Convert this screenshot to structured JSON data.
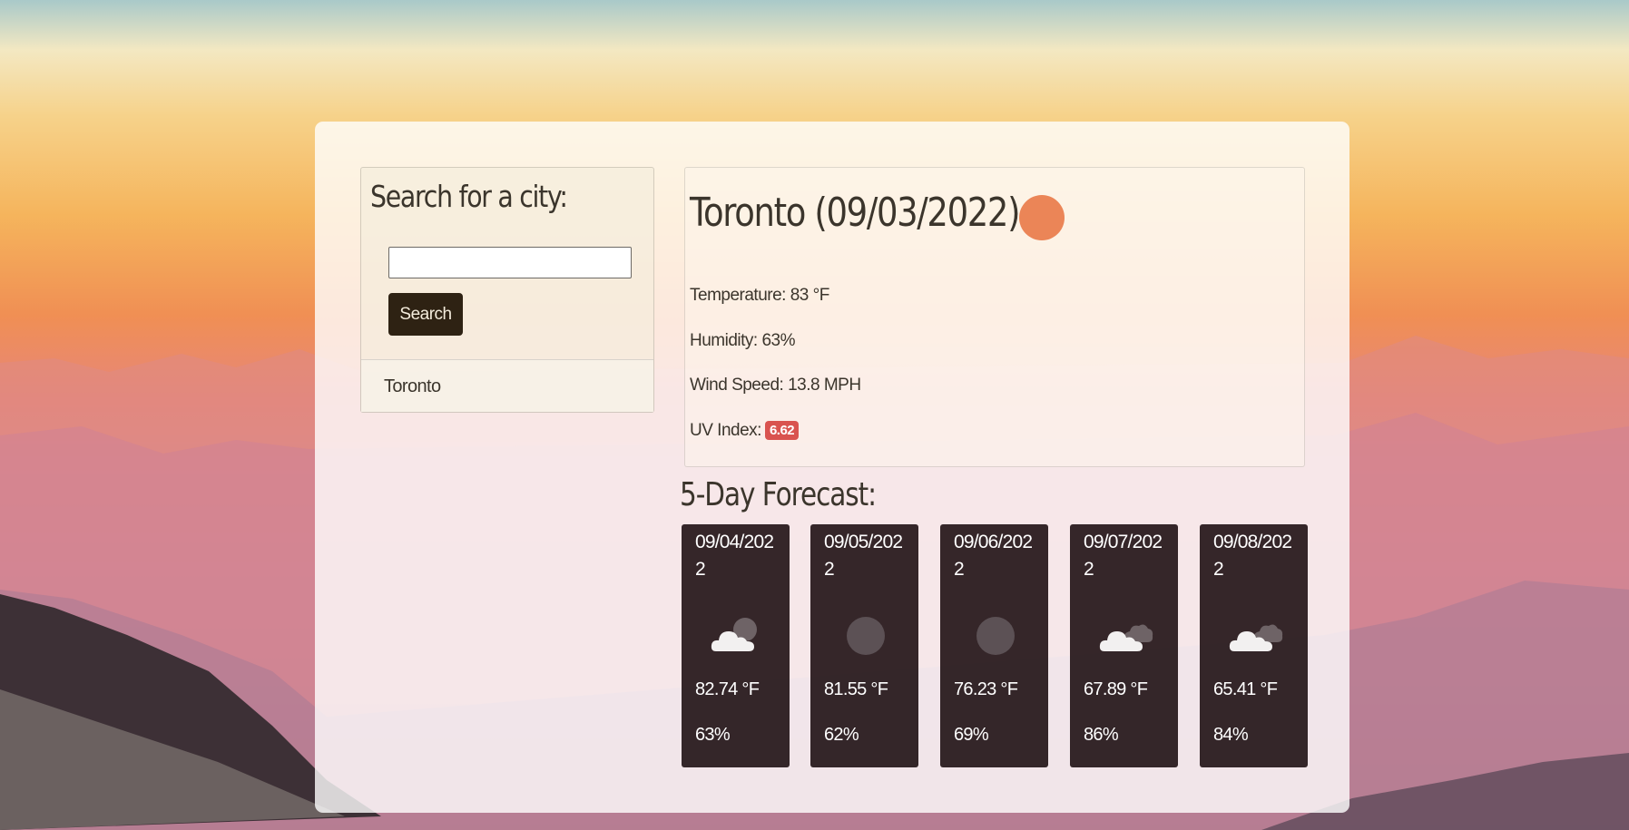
{
  "search": {
    "heading": "Search for a city:",
    "input_value": "",
    "button_label": "Search",
    "history": [
      "Toronto"
    ]
  },
  "current": {
    "title": "Toronto (09/03/2022)",
    "icon": "sun-icon",
    "temperature": "Temperature: 83 °F",
    "humidity": "Humidity: 63%",
    "wind": "Wind Speed: 13.8 MPH",
    "uv_label": "UV Index:",
    "uv_value": "6.62"
  },
  "forecast": {
    "heading": "5-Day Forecast:",
    "days": [
      {
        "date": "09/04/2022",
        "icon": "partly-cloudy-icon",
        "temp": "82.74 °F",
        "humidity": "63%"
      },
      {
        "date": "09/05/2022",
        "icon": "sun-icon",
        "temp": "81.55 °F",
        "humidity": "62%"
      },
      {
        "date": "09/06/2022",
        "icon": "sun-icon",
        "temp": "76.23 °F",
        "humidity": "69%"
      },
      {
        "date": "09/07/2022",
        "icon": "cloudy-icon",
        "temp": "67.89 °F",
        "humidity": "86%"
      },
      {
        "date": "09/08/2022",
        "icon": "cloudy-icon",
        "temp": "65.41 °F",
        "humidity": "84%"
      }
    ]
  },
  "colors": {
    "accent_sun": "#eb8557",
    "button_bg": "#2e2213",
    "uv_badge": "#d9534f",
    "forecast_card_bg": "#241618"
  }
}
